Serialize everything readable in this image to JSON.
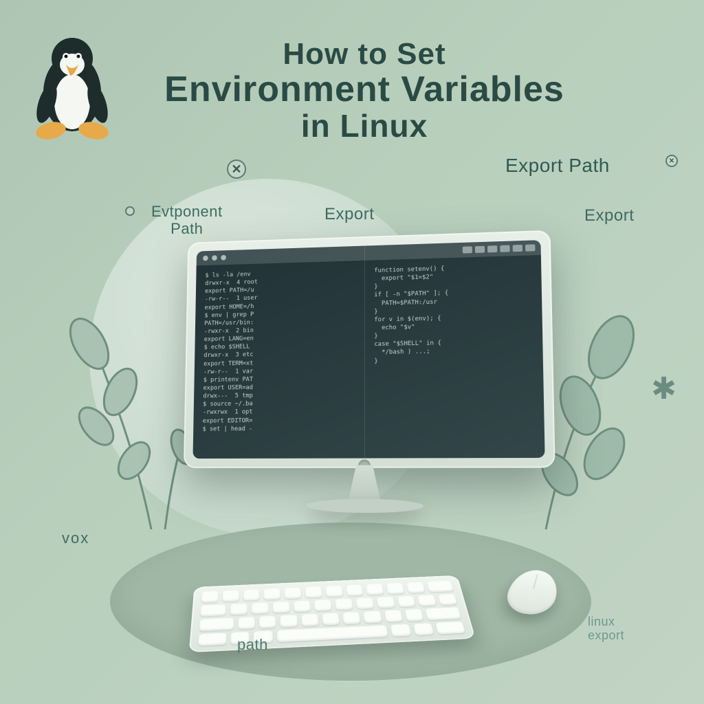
{
  "title": {
    "line1": "How to Set",
    "line2": "Environment Variables",
    "line3": "in Linux"
  },
  "labels": {
    "export_path": "Export Path",
    "export_right": "Export",
    "export_center": "Export",
    "evt_path": "Evtponent\nPath",
    "vox": "vox",
    "path": "path",
    "linux_export": "linux\nexport"
  },
  "icons": {
    "tux": "tux-penguin-icon",
    "close": "✕",
    "asterisk": "✱"
  },
  "terminal": {
    "dots": 3,
    "tabs": 6,
    "left_lines": [
      "$ ls -la /env",
      "drwxr-x  4 root",
      "export PATH=/u",
      "-rw-r--  1 user",
      "export HOME=/h",
      "$ env | grep P",
      "PATH=/usr/bin:",
      "-rwxr-x  2 bin",
      "export LANG=en",
      "$ echo $SHELL",
      "drwxr-x  3 etc",
      "export TERM=xt",
      "-rw-r--  1 var",
      "$ printenv PAT",
      "export USER=ad",
      "drwx---  5 tmp",
      "$ source ~/.ba",
      "-rwxrwx  1 opt",
      "export EDITOR=",
      "$ set | head -"
    ],
    "right_lines": [
      "function setenv() {",
      "  export \"$1=$2\"",
      "}",
      "",
      "if [ -n \"$PATH\" ]; {",
      "  PATH=$PATH:/usr",
      "}",
      "",
      "for v in $(env); {",
      "  echo \"$v\"",
      "}",
      "",
      "case \"$SHELL\" in {",
      "  */bash ) ...;",
      "}",
      ""
    ]
  }
}
